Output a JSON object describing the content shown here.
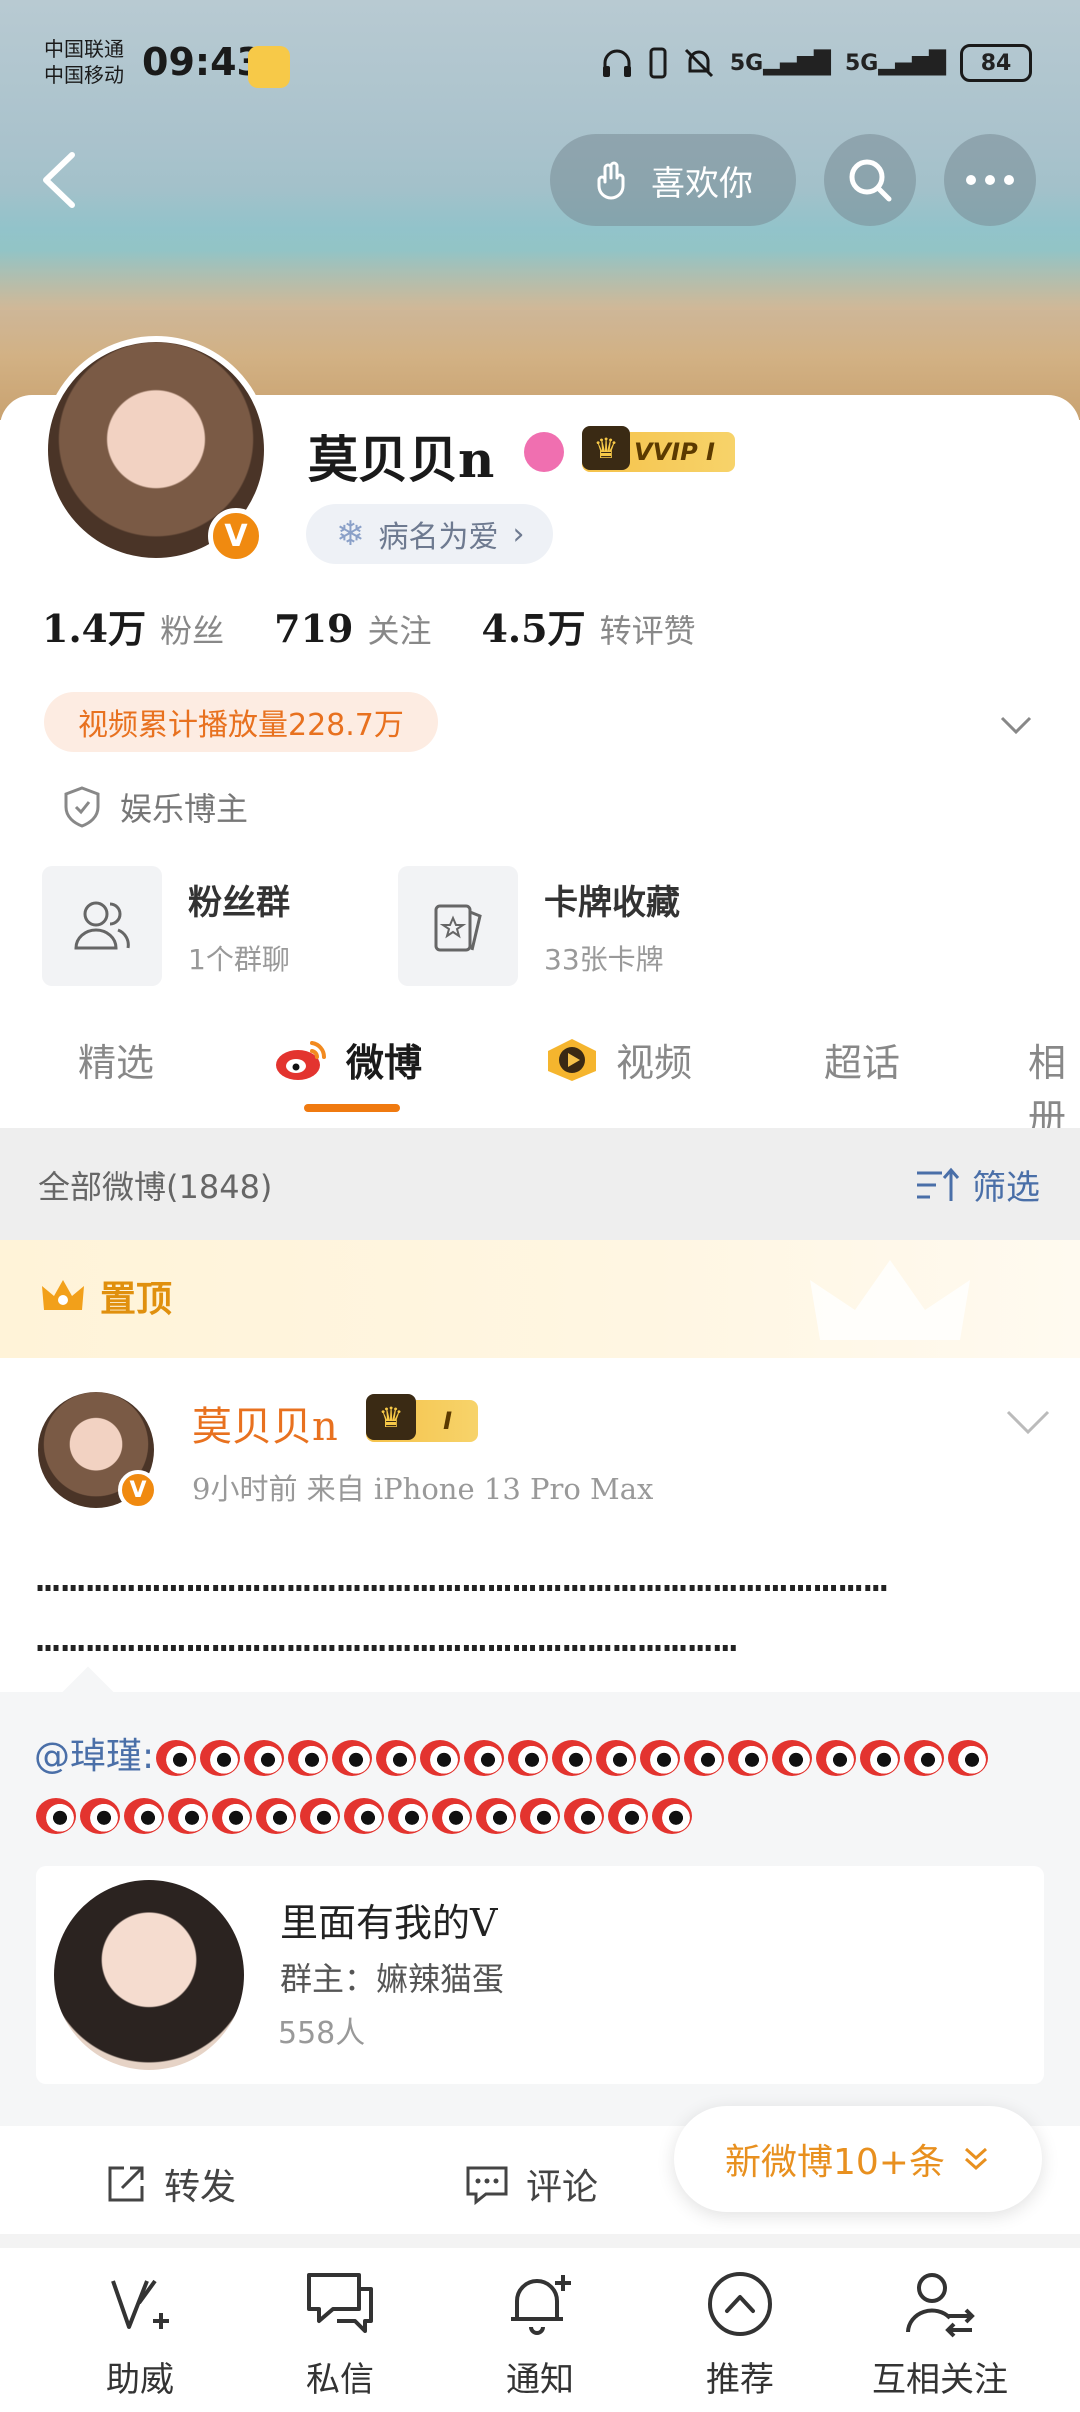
{
  "status_bar": {
    "carrier1": "中国联通",
    "carrier2": "中国移动",
    "time": "09:43",
    "net1": "5G",
    "net2": "5G",
    "battery": "84"
  },
  "header": {
    "like_label": "喜欢你"
  },
  "profile": {
    "nickname": "莫贝贝n",
    "vvip_label": "VVIP I",
    "tag": "病名为爱",
    "stats": [
      {
        "value": "1.4万",
        "label": "粉丝"
      },
      {
        "value": "719",
        "label": "关注"
      },
      {
        "value": "4.5万",
        "label": "转评赞"
      }
    ],
    "play_count": "视频累计播放量228.7万",
    "category": "娱乐博主",
    "tiles": [
      {
        "title": "粉丝群",
        "sub": "1个群聊"
      },
      {
        "title": "卡牌收藏",
        "sub": "33张卡牌"
      }
    ]
  },
  "tabs": [
    {
      "label": "精选",
      "active": false
    },
    {
      "label": "微博",
      "active": true
    },
    {
      "label": "视频",
      "active": false
    },
    {
      "label": "超话",
      "active": false
    },
    {
      "label": "相册",
      "active": false
    }
  ],
  "filter": {
    "all_posts": "全部微博(1848)",
    "filter_label": "筛选"
  },
  "pinned": {
    "label": "置顶"
  },
  "post": {
    "author": "莫贝贝n",
    "vip_label": "I",
    "meta": "9小时前  来自 iPhone 13 Pro Max",
    "text_line1": "…………………………………………………………………………………………",
    "text_line2": "…………………………………………………………………………",
    "repost_user": "@琸瑾",
    "repost_sep": ":",
    "emoji_row1_count": 19,
    "emoji_row2_count": 15,
    "group": {
      "title": "里面有我的V",
      "owner": "群主：嫲辣猫蛋",
      "count": "558人"
    }
  },
  "actions": {
    "repost": "转发",
    "comment": "评论",
    "new_posts": "新微博10+条"
  },
  "bottom_nav": [
    {
      "label": "助威",
      "icon": "cheer-icon"
    },
    {
      "label": "私信",
      "icon": "message-icon"
    },
    {
      "label": "通知",
      "icon": "bell-icon"
    },
    {
      "label": "推荐",
      "icon": "recommend-icon"
    },
    {
      "label": "互相关注",
      "icon": "follow-icon"
    }
  ],
  "colors": {
    "accent": "#f07a10",
    "link": "#4a6fa8",
    "vip_gold": "#f5c24a"
  }
}
